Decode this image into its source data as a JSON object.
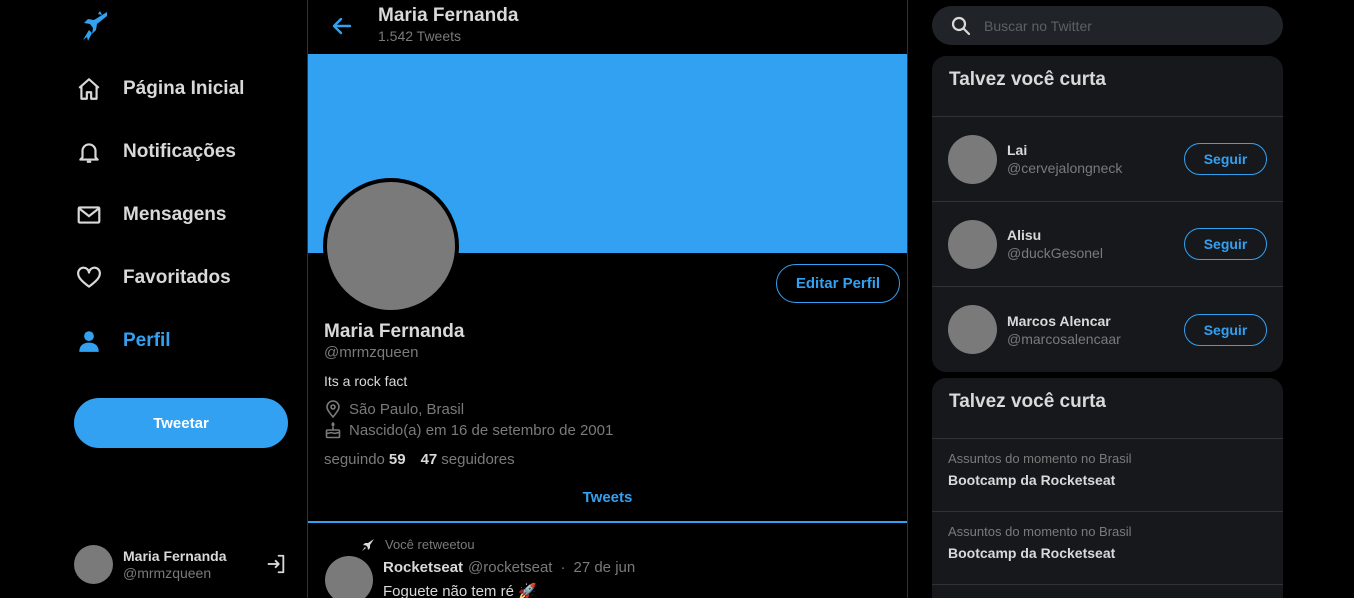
{
  "colors": {
    "accent": "#33a1f2",
    "background": "#000000",
    "card": "#16181c",
    "muted": "#7a7a7a"
  },
  "sidebar": {
    "logo_icon": "rocket-bird-icon",
    "nav": [
      {
        "label": "Página Inicial",
        "icon": "home-icon"
      },
      {
        "label": "Notificações",
        "icon": "bell-icon"
      },
      {
        "label": "Mensagens",
        "icon": "mail-icon"
      },
      {
        "label": "Favoritados",
        "icon": "heart-icon"
      },
      {
        "label": "Perfil",
        "icon": "person-icon",
        "active": true
      }
    ],
    "tweet_button": "Tweetar",
    "account": {
      "name": "Maria Fernanda",
      "handle": "@mrmzqueen",
      "exit_icon": "exit-icon"
    }
  },
  "header": {
    "name": "Maria Fernanda",
    "tweet_count": "1.542 Tweets"
  },
  "profile": {
    "edit_button": "Editar Perfil",
    "name": "Maria Fernanda",
    "handle": "@mrmzqueen",
    "bio": "Its a rock fact",
    "location": "São Paulo, Brasil",
    "birthday": "Nascido(a) em 16 de setembro de 2001",
    "following_label": "seguindo",
    "following_count": "59",
    "followers_count": "47",
    "followers_label": "seguidores",
    "tab": "Tweets"
  },
  "tweet": {
    "retweet_label": "Você retweetou",
    "author": "Rocketseat",
    "handle": "@rocketseat",
    "separator": "·",
    "date": "27 de jun",
    "text": "Foguete não tem ré 🚀"
  },
  "search": {
    "placeholder": "Buscar no Twitter"
  },
  "who_to_follow": {
    "title": "Talvez você curta",
    "follow_label": "Seguir",
    "users": [
      {
        "name": "Lai",
        "handle": "@cervejalongneck"
      },
      {
        "name": "Alisu",
        "handle": "@duckGesonel"
      },
      {
        "name": "Marcos Alencar",
        "handle": "@marcosalencaar"
      }
    ]
  },
  "trends": {
    "title": "Talvez você curta",
    "items": [
      {
        "category": "Assuntos do momento no Brasil",
        "name": "Bootcamp da Rocketseat"
      },
      {
        "category": "Assuntos do momento no Brasil",
        "name": "Bootcamp da Rocketseat"
      }
    ]
  }
}
